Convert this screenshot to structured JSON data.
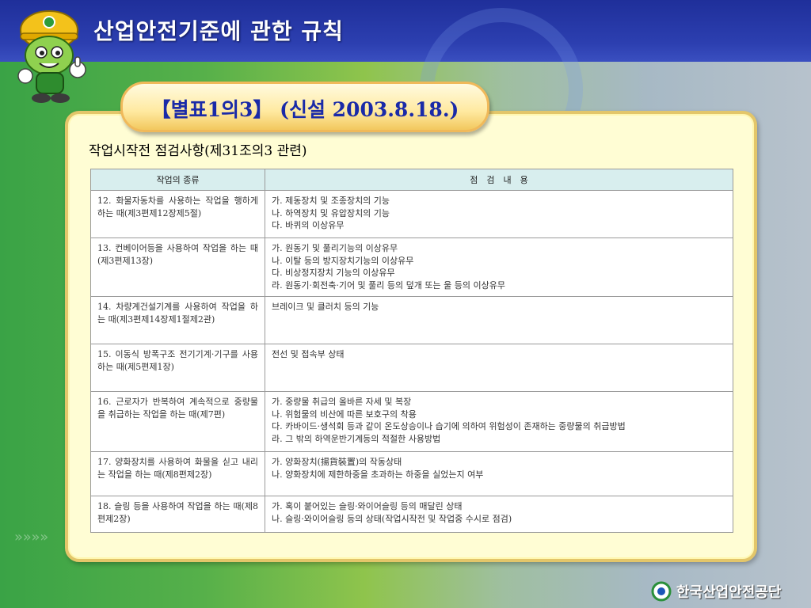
{
  "header": {
    "title": "산업안전기준에 관한 규칙"
  },
  "badge": {
    "text": "【별표1의3】 (신설 2003.8.18.)"
  },
  "doc": {
    "title": "작업시작전 점검사항(제31조의3 관련)"
  },
  "table": {
    "headers": [
      "작업의 종류",
      "점　검　내　용"
    ],
    "rows": [
      {
        "type": "12. 화물자동차를 사용하는 작업을 행하게 하는 때(제3편제12장제5절)",
        "lines": [
          "가. 제동장치 및 조종장치의 기능",
          "나. 하역장치 및 유압장치의 기능",
          "다. 바퀴의 이상유무"
        ]
      },
      {
        "type": "13. 컨베이어등을 사용하여 작업을 하는 때(제3편제13장)",
        "lines": [
          "가. 원동기 및 풀리기능의 이상유무",
          "나. 이탈 등의 방지장치기능의 이상유무",
          "다. 비상정지장치 기능의 이상유무",
          "라. 원동기·회전축·기어 및 풀리 등의 덮개 또는 울 등의 이상유무"
        ]
      },
      {
        "type": "14. 차량계건설기계를 사용하여 작업을 하는 때(제3편제14장제1절제2관)",
        "lines": [
          "브레이크 및 클러치 등의 기능"
        ]
      },
      {
        "type": "15. 이동식 방폭구조 전기기계·기구를 사용하는 때(제5편제1장)",
        "lines": [
          "전선 및 접속부 상태"
        ]
      },
      {
        "type": "16. 근로자가 반복하여 계속적으로 중량물을 취급하는 작업을 하는 때(제7편)",
        "lines": [
          "가. 중량물 취급의 올바른 자세 및 복장",
          "나. 위험물의 비산에 따른 보호구의 착용",
          "다. 카바이드·생석회 등과 같이 온도상승이나 습기에 의하여 위험성이 존재하는 중량물의 취급방법",
          "라. 그 밖의 하역운반기계등의 적절한 사용방법"
        ]
      },
      {
        "type": "17. 양화장치를 사용하여 화물을 싣고 내리는 작업을 하는 때(제8편제2장)",
        "lines": [
          "가. 양화장치(揚貨裝置)의 작동상태",
          "나. 양화장치에 제한하중을 초과하는 하중을 실었는지 여부"
        ]
      },
      {
        "type": "18. 슬링 등을 사용하여 작업을 하는 때(제8편제2장)",
        "lines": [
          "가. 혹이 붙어있는 슬링·와이어슬링 등의 매달린 상태",
          "나. 슬링·와이어슬링 등의 상태(작업시작전 및 작업중 수시로 점검)"
        ]
      }
    ]
  },
  "footer": {
    "org_name": "한국산업안전공단"
  },
  "colors": {
    "header_blue": "#2c3fb0",
    "badge_text": "#1a2aa8",
    "panel_bg": "#fffdd4",
    "table_header_bg": "#d8eeee"
  }
}
